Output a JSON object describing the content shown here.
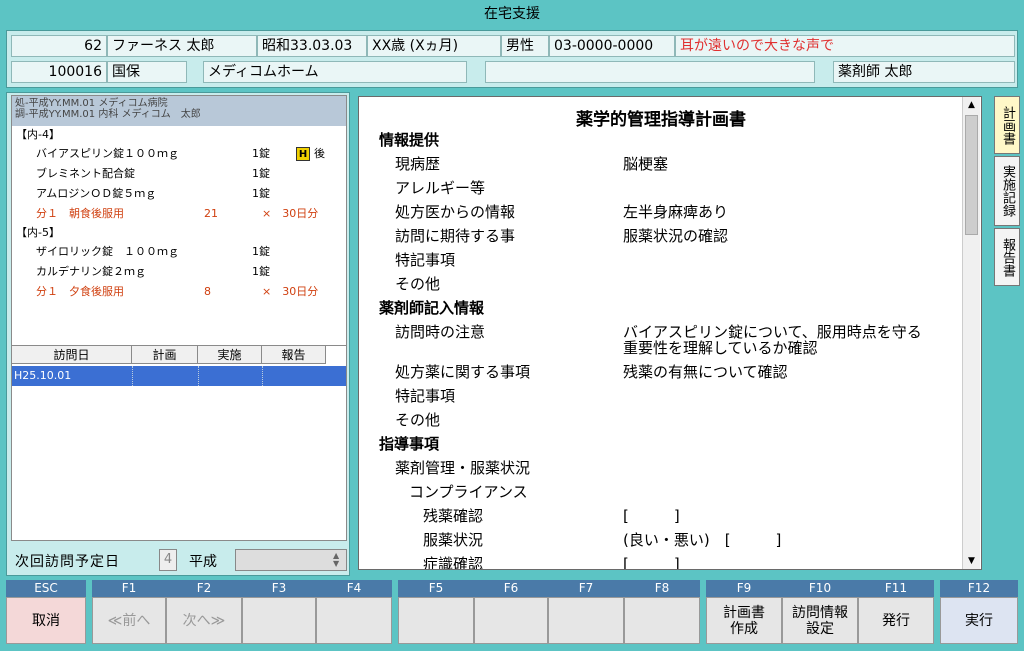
{
  "window": {
    "title": "在宅支援"
  },
  "patient": {
    "id": "62",
    "name": "ファーネス 太郎",
    "birth": "昭和33.03.03",
    "age": "XX歳 (Xヵ月)",
    "sex": "男性",
    "phone": "03-0000-0000",
    "note": "耳が遠いので大きな声で",
    "insurer_no": "100016",
    "insurance": "国保",
    "facility": "メディコムホーム",
    "blank": "",
    "pharmacist": "薬剤師 太郎"
  },
  "prescription": {
    "header1": "処-平成YY.MM.01 メディコム病院",
    "header2": "調-平成YY.MM.01 内科 メディコム　太郎",
    "groups": [
      {
        "title": "【内-4】",
        "drugs": [
          {
            "name": "バイアスピリン錠１００ｍｇ",
            "qty": "1錠",
            "badge": "H",
            "badge_note": "後"
          },
          {
            "name": "ブレミネント配合錠",
            "qty": "1錠"
          },
          {
            "name": "アムロジンＯＤ錠５ｍｇ",
            "qty": "1錠"
          }
        ],
        "usage": {
          "text": "分１　朝食後服用",
          "days": "21",
          "mult": "×　30日分"
        }
      },
      {
        "title": "【内-5】",
        "drugs": [
          {
            "name": "ザイロリック錠　１００ｍｇ",
            "qty": "1錠"
          },
          {
            "name": "カルデナリン錠２ｍｇ",
            "qty": "1錠"
          }
        ],
        "usage": {
          "text": "分１　夕食後服用",
          "days": "8",
          "mult": "×　30日分"
        }
      }
    ]
  },
  "visits": {
    "columns": [
      "訪問日",
      "計画",
      "実施",
      "報告"
    ],
    "rows": [
      {
        "date": "H25.10.01"
      }
    ]
  },
  "next_visit": {
    "label": "次回訪問予定日",
    "era_code": "4",
    "era": "平成",
    "value": ""
  },
  "document": {
    "title": "薬学的管理指導計画書",
    "sections": {
      "s1": "情報提供",
      "s1_items": [
        "現病歴",
        "アレルギー等",
        "処方医からの情報",
        "訪問に期待する事",
        "特記事項",
        "その他"
      ],
      "s1_values": [
        "脳梗塞",
        "",
        "左半身麻痺あり",
        "服薬状況の確認",
        "",
        ""
      ],
      "s2": "薬剤師記入情報",
      "s2_items": [
        "訪問時の注意",
        "処方薬に関する事項",
        "特記事項",
        "その他"
      ],
      "s2_values": [
        "バイアスピリン錠について、服用時点を守る",
        "残薬の有無について確認",
        "",
        ""
      ],
      "s2_value_cont": "重要性を理解しているか確認",
      "s3": "指導事項",
      "s3_sub": "薬剤管理・服薬状況",
      "s3_sub2": "コンプライアンス",
      "s3_items": [
        "残薬確認",
        "服薬状況",
        "症識確認"
      ],
      "s3_values": [
        "[　　　]",
        "(良い・悪い)　[　　　]",
        "[　　　]"
      ]
    }
  },
  "side_tabs": [
    "計画書",
    "実施記録",
    "報告書"
  ],
  "fkeys": [
    {
      "key": "ESC",
      "label": "取消"
    },
    {
      "key": "F1",
      "label": "≪前へ"
    },
    {
      "key": "F2",
      "label": "次へ≫"
    },
    {
      "key": "F3",
      "label": ""
    },
    {
      "key": "F4",
      "label": ""
    },
    {
      "key": "F5",
      "label": ""
    },
    {
      "key": "F6",
      "label": ""
    },
    {
      "key": "F7",
      "label": ""
    },
    {
      "key": "F8",
      "label": ""
    },
    {
      "key": "F9",
      "label": "計画書\n作成"
    },
    {
      "key": "F10",
      "label": "訪問情報\n設定"
    },
    {
      "key": "F11",
      "label": "発行"
    },
    {
      "key": "F12",
      "label": "実行"
    }
  ],
  "colors": {
    "bg": "#5cc4c4",
    "selected_row": "#3b6fd3",
    "note_red": "#e03030",
    "usage_red": "#d04010"
  }
}
